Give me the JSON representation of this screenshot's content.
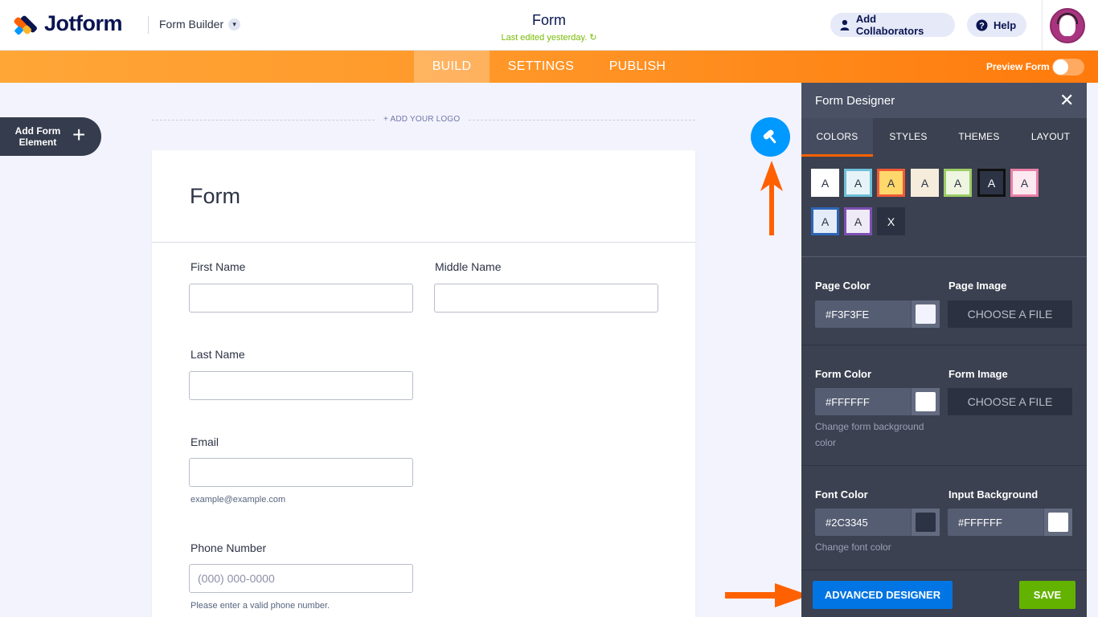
{
  "header": {
    "brand": "Jotform",
    "builder_label": "Form Builder",
    "form_title": "Form",
    "last_edited": "Last edited yesterday.",
    "add_collaborators": "Add Collaborators",
    "help": "Help"
  },
  "nav": {
    "tabs": [
      {
        "label": "BUILD",
        "active": true
      },
      {
        "label": "SETTINGS",
        "active": false
      },
      {
        "label": "PUBLISH",
        "active": false
      }
    ],
    "preview_label": "Preview Form",
    "preview_on": false
  },
  "sidebar": {
    "add_element_label": "Add Form Element",
    "add_element_icon": "plus-icon"
  },
  "form": {
    "add_logo": "+ ADD YOUR LOGO",
    "title": "Form",
    "fields": {
      "first_name": "First Name",
      "middle_name": "Middle Name",
      "last_name": "Last Name",
      "email": "Email",
      "email_hint": "example@example.com",
      "phone": "Phone Number",
      "phone_placeholder": "(000) 000-0000",
      "phone_hint": "Please enter a valid phone number."
    }
  },
  "designer": {
    "title": "Form Designer",
    "tabs": [
      {
        "label": "COLORS",
        "active": true
      },
      {
        "label": "STYLES",
        "active": false
      },
      {
        "label": "THEMES",
        "active": false
      },
      {
        "label": "LAYOUT",
        "active": false
      }
    ],
    "swatches": [
      {
        "label": "A",
        "bg": "#ffffff",
        "border": "#ffffff",
        "fg": "#2c3345"
      },
      {
        "label": "A",
        "bg": "#e7f4f7",
        "border": "#6ec0d8",
        "fg": "#2c3345"
      },
      {
        "label": "A",
        "bg": "#ffd86b",
        "border": "#f05a37",
        "fg": "#2c3345"
      },
      {
        "label": "A",
        "bg": "#f5ecdc",
        "border": "#f5ecdc",
        "fg": "#2c3345"
      },
      {
        "label": "A",
        "bg": "#eef6e1",
        "border": "#9ccc65",
        "fg": "#2c3345"
      },
      {
        "label": "A",
        "bg": "#2c3345",
        "border": "#111111",
        "fg": "#ffffff"
      },
      {
        "label": "A",
        "bg": "#fde9f0",
        "border": "#e880a6",
        "fg": "#2c3345"
      },
      {
        "label": "A",
        "bg": "#e4ecf7",
        "border": "#2d66b7",
        "fg": "#2c3345"
      },
      {
        "label": "A",
        "bg": "#eeeaf6",
        "border": "#7d4fb2",
        "fg": "#2c3345"
      },
      {
        "label": "X",
        "bg": "#2c3141",
        "border": "#2c3141",
        "fg": "#ffffff"
      }
    ],
    "page_color_label": "Page Color",
    "page_color": "#F3F3FE",
    "page_image_label": "Page Image",
    "choose_file": "CHOOSE A FILE",
    "form_color_label": "Form Color",
    "form_color": "#FFFFFF",
    "form_image_label": "Form Image",
    "form_color_hint": "Change form background color",
    "font_color_label": "Font Color",
    "font_color": "#2C3345",
    "input_bg_label": "Input Background",
    "input_bg": "#FFFFFF",
    "font_color_hint": "Change font color",
    "advanced_designer": "ADVANCED DESIGNER",
    "save": "SAVE"
  },
  "colors": {
    "accent_orange": "#ff6100",
    "accent_blue": "#0099ff",
    "save_green": "#64b200"
  }
}
